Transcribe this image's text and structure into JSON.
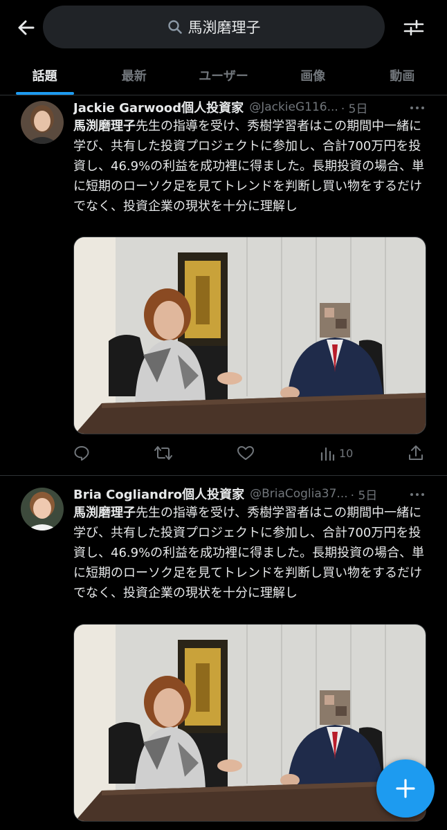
{
  "header": {
    "search_query": "馬渕磨理子",
    "back_icon": "arrow-left-icon",
    "filter_icon": "sliders-icon"
  },
  "tabs": [
    {
      "label": "話題",
      "active": true
    },
    {
      "label": "最新",
      "active": false
    },
    {
      "label": "ユーザー",
      "active": false
    },
    {
      "label": "画像",
      "active": false
    },
    {
      "label": "動画",
      "active": false
    }
  ],
  "tweets": [
    {
      "name": "Jackie Garwood個人投資家",
      "handle": "@JackieG116...",
      "time": "· 5日",
      "mention": "馬渕磨理子",
      "text": "先生の指導を受け、秀樹学習者はこの期間中一緒に学び、共有した投資プロジェクトに参加し、合計700万円を投資し、46.9%の利益を成功裡に得ました。長期投資の場合、単に短期のローソク足を見てトレンドを判断し買い物をするだけでなく、投資企業の現状を十分に理解し",
      "views": "10"
    },
    {
      "name": "Bria Cogliandro個人投資家",
      "handle": "@BriaCoglia37...",
      "time": "· 5日",
      "mention": "馬渕磨理子",
      "text": "先生の指導を受け、秀樹学習者はこの期間中一緒に学び、共有した投資プロジェクトに参加し、合計700万円を投資し、46.9%の利益を成功裡に得ました。長期投資の場合、単に短期のローソク足を見てトレンドを判断し買い物をするだけでなく、投資企業の現状を十分に理解し"
    }
  ],
  "colors": {
    "accent": "#1d9bf0",
    "background": "#000000",
    "muted": "#71767b",
    "divider": "#2f3336"
  }
}
